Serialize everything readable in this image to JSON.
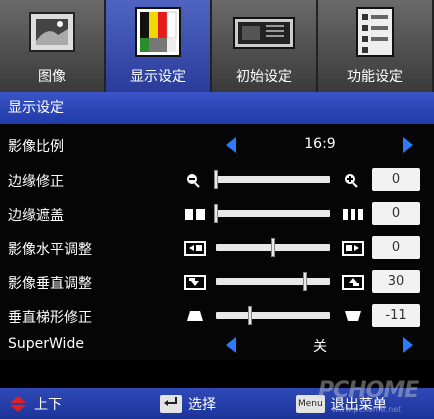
{
  "tabs": [
    {
      "label": "图像",
      "icon": "picture-icon"
    },
    {
      "label": "显示设定",
      "icon": "color-bars-icon",
      "active": true
    },
    {
      "label": "初始设定",
      "icon": "projector-icon"
    },
    {
      "label": "功能设定",
      "icon": "checklist-icon"
    }
  ],
  "section_title": "显示设定",
  "rows": [
    {
      "label": "影像比例",
      "type": "choice",
      "value": "16:9"
    },
    {
      "label": "边缘修正",
      "type": "slider",
      "value": "0",
      "level": 0.0
    },
    {
      "label": "边缘遮盖",
      "type": "slider",
      "value": "0",
      "level": 0.0
    },
    {
      "label": "影像水平调整",
      "type": "slider",
      "value": "0",
      "level": 0.5
    },
    {
      "label": "影像垂直调整",
      "type": "slider",
      "value": "30",
      "level": 0.78
    },
    {
      "label": "垂直梯形修正",
      "type": "slider",
      "value": "-11",
      "level": 0.3
    },
    {
      "label": "SuperWide",
      "type": "choice",
      "value": "关"
    }
  ],
  "footer": {
    "updown": "上下",
    "select": "选择",
    "menu_key": "Menu",
    "exit": "退出菜单"
  },
  "watermark": {
    "brand": "PCHOME",
    "url": "www.pchome.net"
  },
  "colors": {
    "accent": "#2c7bff",
    "tab_active": "#3b55c8",
    "header": "#203aa8"
  }
}
